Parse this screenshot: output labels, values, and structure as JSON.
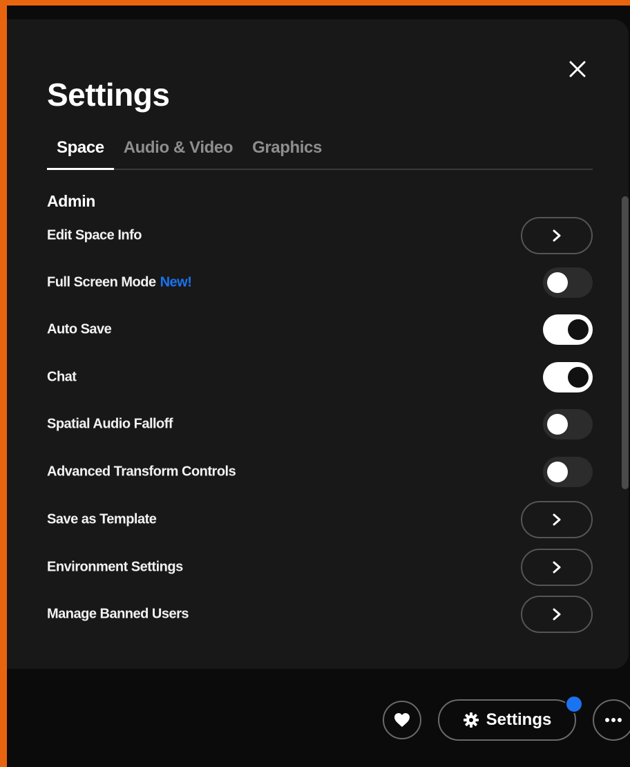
{
  "panel": {
    "title": "Settings",
    "tabs": [
      {
        "label": "Space",
        "active": true
      },
      {
        "label": "Audio & Video",
        "active": false
      },
      {
        "label": "Graphics",
        "active": false
      }
    ],
    "section": "Admin",
    "rows": [
      {
        "label": "Edit Space Info",
        "control": "chevron"
      },
      {
        "label": "Full Screen Mode",
        "badge": "New!",
        "control": "toggle",
        "on": false
      },
      {
        "label": "Auto Save",
        "control": "toggle",
        "on": true
      },
      {
        "label": "Chat",
        "control": "toggle",
        "on": true
      },
      {
        "label": "Spatial Audio Falloff",
        "control": "toggle",
        "on": false
      },
      {
        "label": "Advanced Transform Controls",
        "control": "toggle",
        "on": false
      },
      {
        "label": "Save as Template",
        "control": "chevron"
      },
      {
        "label": "Environment Settings",
        "control": "chevron"
      },
      {
        "label": "Manage Banned Users",
        "control": "chevron"
      }
    ]
  },
  "bottom_bar": {
    "settings_label": "Settings",
    "has_notification": true
  },
  "icons": {
    "close": "close-icon",
    "chevron": "chevron-right-icon",
    "heart": "heart-icon",
    "gear": "gear-icon",
    "more": "more-horizontal-icon"
  },
  "colors": {
    "accent_blue": "#1a73f0",
    "panel_bg": "#181818",
    "frame_border": "#e8650f"
  }
}
